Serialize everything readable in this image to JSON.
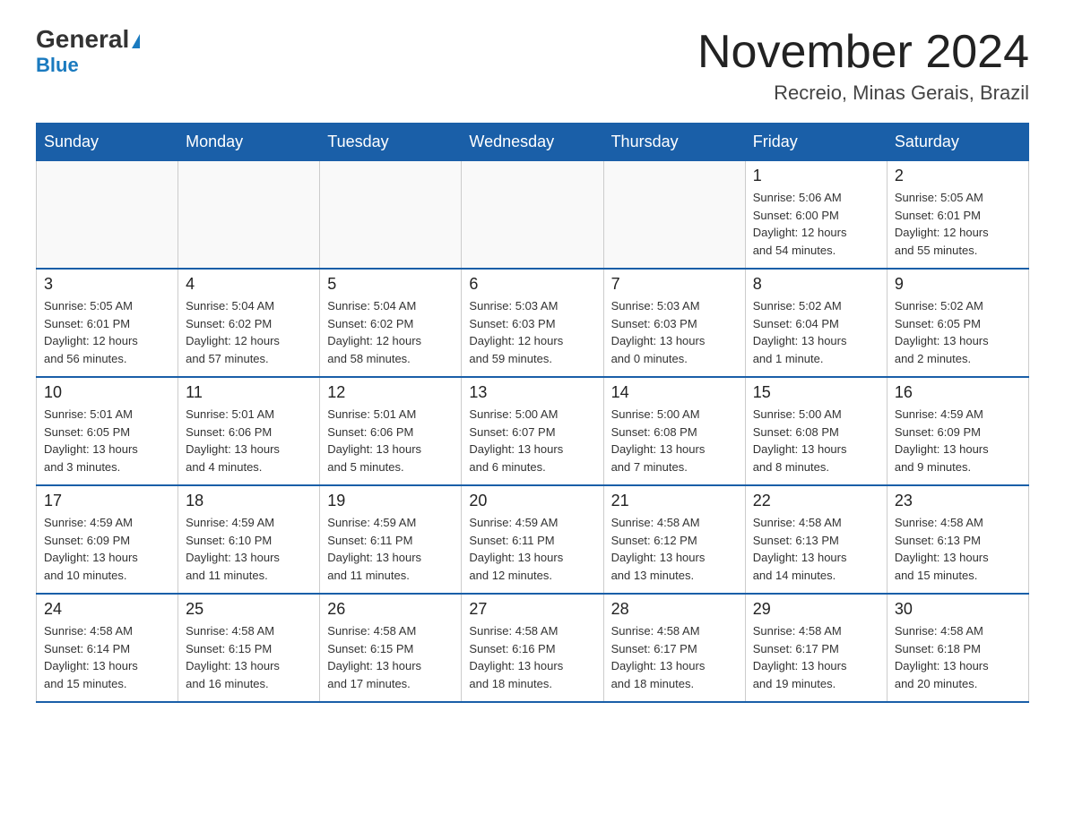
{
  "header": {
    "logo_general": "General",
    "logo_blue": "Blue",
    "title": "November 2024",
    "subtitle": "Recreio, Minas Gerais, Brazil"
  },
  "weekdays": [
    "Sunday",
    "Monday",
    "Tuesday",
    "Wednesday",
    "Thursday",
    "Friday",
    "Saturday"
  ],
  "weeks": [
    [
      {
        "day": "",
        "info": ""
      },
      {
        "day": "",
        "info": ""
      },
      {
        "day": "",
        "info": ""
      },
      {
        "day": "",
        "info": ""
      },
      {
        "day": "",
        "info": ""
      },
      {
        "day": "1",
        "info": "Sunrise: 5:06 AM\nSunset: 6:00 PM\nDaylight: 12 hours\nand 54 minutes."
      },
      {
        "day": "2",
        "info": "Sunrise: 5:05 AM\nSunset: 6:01 PM\nDaylight: 12 hours\nand 55 minutes."
      }
    ],
    [
      {
        "day": "3",
        "info": "Sunrise: 5:05 AM\nSunset: 6:01 PM\nDaylight: 12 hours\nand 56 minutes."
      },
      {
        "day": "4",
        "info": "Sunrise: 5:04 AM\nSunset: 6:02 PM\nDaylight: 12 hours\nand 57 minutes."
      },
      {
        "day": "5",
        "info": "Sunrise: 5:04 AM\nSunset: 6:02 PM\nDaylight: 12 hours\nand 58 minutes."
      },
      {
        "day": "6",
        "info": "Sunrise: 5:03 AM\nSunset: 6:03 PM\nDaylight: 12 hours\nand 59 minutes."
      },
      {
        "day": "7",
        "info": "Sunrise: 5:03 AM\nSunset: 6:03 PM\nDaylight: 13 hours\nand 0 minutes."
      },
      {
        "day": "8",
        "info": "Sunrise: 5:02 AM\nSunset: 6:04 PM\nDaylight: 13 hours\nand 1 minute."
      },
      {
        "day": "9",
        "info": "Sunrise: 5:02 AM\nSunset: 6:05 PM\nDaylight: 13 hours\nand 2 minutes."
      }
    ],
    [
      {
        "day": "10",
        "info": "Sunrise: 5:01 AM\nSunset: 6:05 PM\nDaylight: 13 hours\nand 3 minutes."
      },
      {
        "day": "11",
        "info": "Sunrise: 5:01 AM\nSunset: 6:06 PM\nDaylight: 13 hours\nand 4 minutes."
      },
      {
        "day": "12",
        "info": "Sunrise: 5:01 AM\nSunset: 6:06 PM\nDaylight: 13 hours\nand 5 minutes."
      },
      {
        "day": "13",
        "info": "Sunrise: 5:00 AM\nSunset: 6:07 PM\nDaylight: 13 hours\nand 6 minutes."
      },
      {
        "day": "14",
        "info": "Sunrise: 5:00 AM\nSunset: 6:08 PM\nDaylight: 13 hours\nand 7 minutes."
      },
      {
        "day": "15",
        "info": "Sunrise: 5:00 AM\nSunset: 6:08 PM\nDaylight: 13 hours\nand 8 minutes."
      },
      {
        "day": "16",
        "info": "Sunrise: 4:59 AM\nSunset: 6:09 PM\nDaylight: 13 hours\nand 9 minutes."
      }
    ],
    [
      {
        "day": "17",
        "info": "Sunrise: 4:59 AM\nSunset: 6:09 PM\nDaylight: 13 hours\nand 10 minutes."
      },
      {
        "day": "18",
        "info": "Sunrise: 4:59 AM\nSunset: 6:10 PM\nDaylight: 13 hours\nand 11 minutes."
      },
      {
        "day": "19",
        "info": "Sunrise: 4:59 AM\nSunset: 6:11 PM\nDaylight: 13 hours\nand 11 minutes."
      },
      {
        "day": "20",
        "info": "Sunrise: 4:59 AM\nSunset: 6:11 PM\nDaylight: 13 hours\nand 12 minutes."
      },
      {
        "day": "21",
        "info": "Sunrise: 4:58 AM\nSunset: 6:12 PM\nDaylight: 13 hours\nand 13 minutes."
      },
      {
        "day": "22",
        "info": "Sunrise: 4:58 AM\nSunset: 6:13 PM\nDaylight: 13 hours\nand 14 minutes."
      },
      {
        "day": "23",
        "info": "Sunrise: 4:58 AM\nSunset: 6:13 PM\nDaylight: 13 hours\nand 15 minutes."
      }
    ],
    [
      {
        "day": "24",
        "info": "Sunrise: 4:58 AM\nSunset: 6:14 PM\nDaylight: 13 hours\nand 15 minutes."
      },
      {
        "day": "25",
        "info": "Sunrise: 4:58 AM\nSunset: 6:15 PM\nDaylight: 13 hours\nand 16 minutes."
      },
      {
        "day": "26",
        "info": "Sunrise: 4:58 AM\nSunset: 6:15 PM\nDaylight: 13 hours\nand 17 minutes."
      },
      {
        "day": "27",
        "info": "Sunrise: 4:58 AM\nSunset: 6:16 PM\nDaylight: 13 hours\nand 18 minutes."
      },
      {
        "day": "28",
        "info": "Sunrise: 4:58 AM\nSunset: 6:17 PM\nDaylight: 13 hours\nand 18 minutes."
      },
      {
        "day": "29",
        "info": "Sunrise: 4:58 AM\nSunset: 6:17 PM\nDaylight: 13 hours\nand 19 minutes."
      },
      {
        "day": "30",
        "info": "Sunrise: 4:58 AM\nSunset: 6:18 PM\nDaylight: 13 hours\nand 20 minutes."
      }
    ]
  ]
}
